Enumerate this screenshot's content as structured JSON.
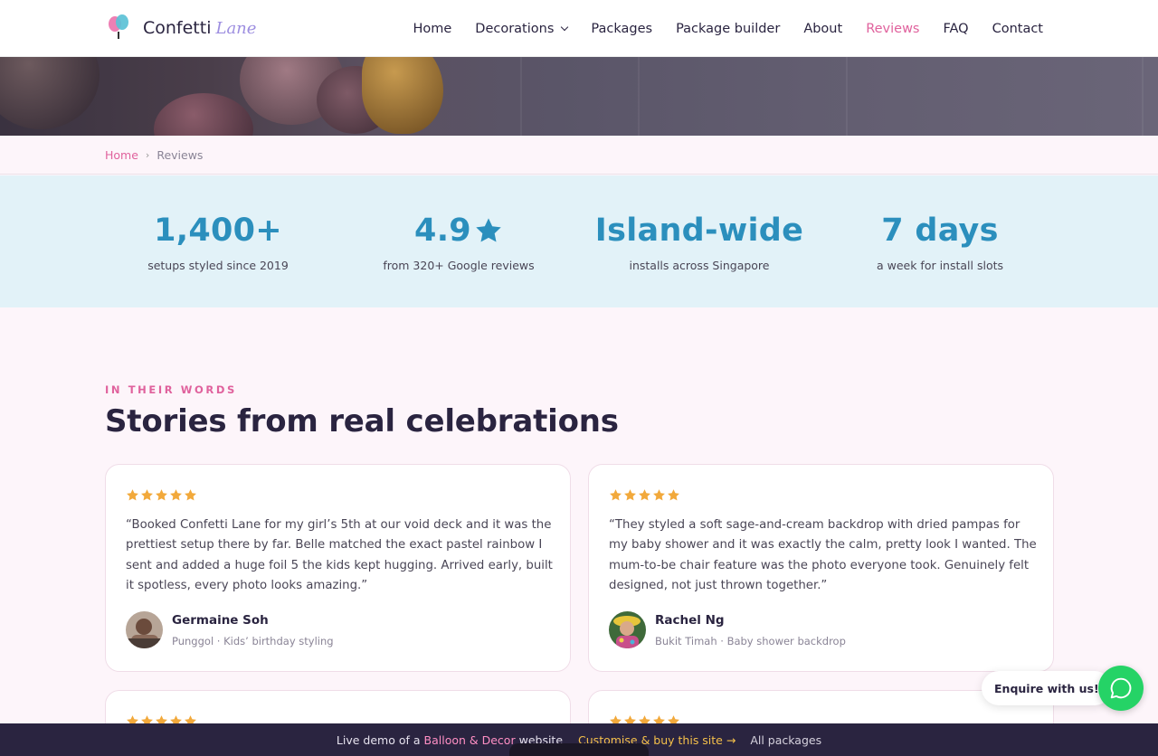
{
  "brand": {
    "name": "Confetti",
    "accent": "Lane",
    "logo_icon": "balloon-logo-icon"
  },
  "nav": {
    "items": [
      {
        "label": "Home",
        "active": false
      },
      {
        "label": "Decorations",
        "active": false,
        "dropdown": true
      },
      {
        "label": "Packages",
        "active": false
      },
      {
        "label": "Package builder",
        "active": false
      },
      {
        "label": "About",
        "active": false
      },
      {
        "label": "Reviews",
        "active": true
      },
      {
        "label": "FAQ",
        "active": false
      },
      {
        "label": "Contact",
        "active": false
      }
    ]
  },
  "breadcrumb": {
    "home": "Home",
    "separator": "›",
    "current": "Reviews"
  },
  "stats": [
    {
      "value": "1,400+",
      "label": "setups styled since 2019"
    },
    {
      "value": "4.9",
      "icon": "star-icon",
      "label": "from 320+ Google reviews"
    },
    {
      "value": "Island-wide",
      "label": "installs across Singapore"
    },
    {
      "value": "7 days",
      "label": "a week for install slots"
    }
  ],
  "section": {
    "eyebrow": "IN THEIR WORDS",
    "title": "Stories from real celebrations"
  },
  "reviews": [
    {
      "rating": 5,
      "quote": "“Booked Confetti Lane for my girl’s 5th at our void deck and it was the prettiest setup there by far. Belle matched the exact pastel rainbow I sent and added a huge foil 5 the kids kept hugging. Arrived early, built it spotless, every photo looks amazing.”",
      "name": "Germaine Soh",
      "meta": "Punggol · Kids’ birthday styling"
    },
    {
      "rating": 5,
      "quote": "“They styled a soft sage-and-cream backdrop with dried pampas for my baby shower and it was exactly the calm, pretty look I wanted. The mum-to-be chair feature was the photo everyone took. Genuinely felt designed, not just thrown together.”",
      "name": "Rachel Ng",
      "meta": "Bukit Timah · Baby shower backdrop"
    },
    {
      "rating": 5
    },
    {
      "rating": 5
    }
  ],
  "floating": {
    "enquire_label": "Enquire with us!",
    "chat_icon": "whatsapp-icon"
  },
  "demo_bar": {
    "prefix": "Live demo of a",
    "highlight": "Balloon & Decor",
    "suffix": "website",
    "cta": "Customise & buy this site →",
    "all": "All packages"
  },
  "colors": {
    "accent_pink": "#e0629d",
    "accent_blue": "#2b8fbd",
    "star": "#f2a93b",
    "whatsapp": "#25d366",
    "dark": "#2a2440"
  }
}
